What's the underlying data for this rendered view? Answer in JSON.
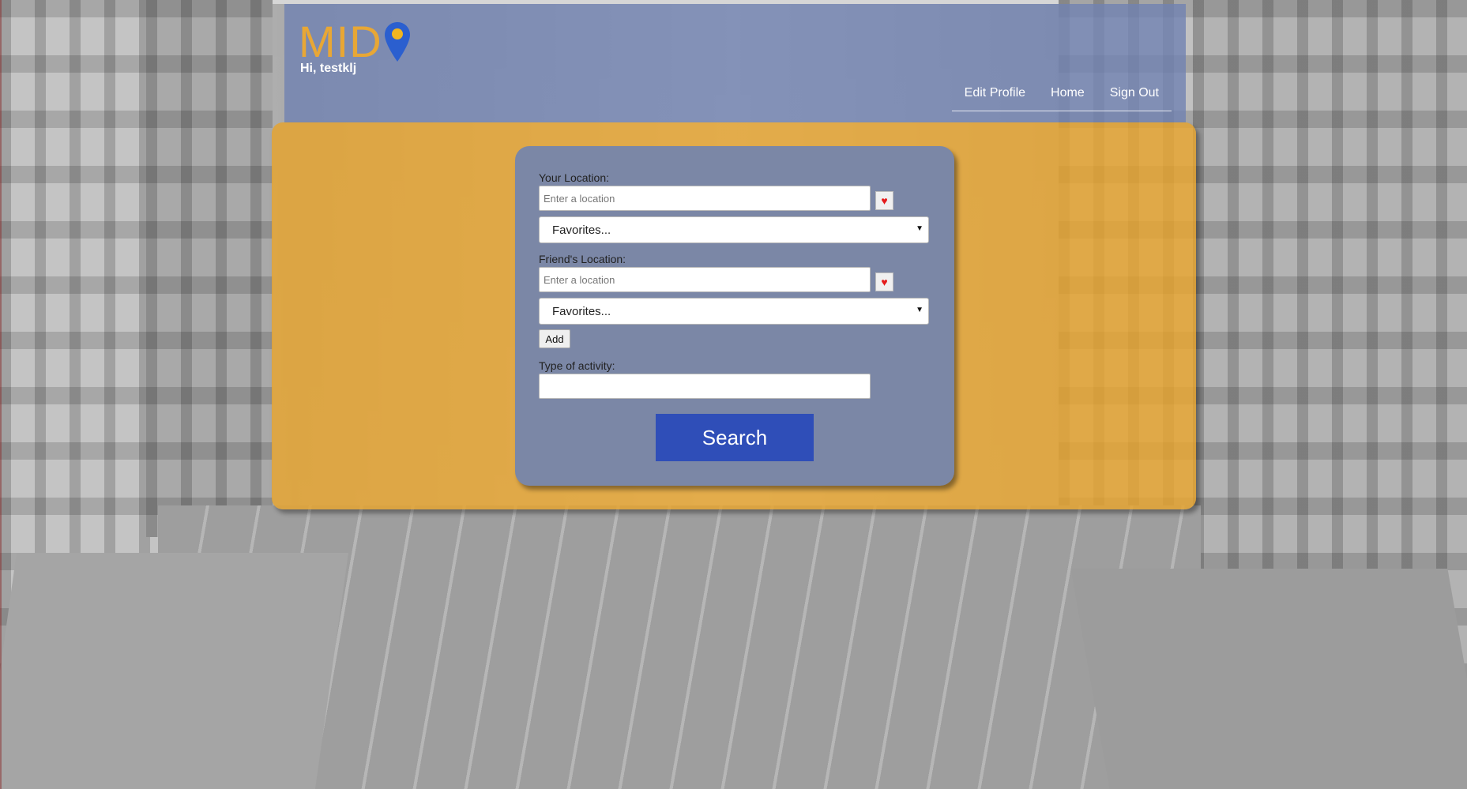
{
  "header": {
    "logo_text": "MID",
    "greeting": "Hi, testklj",
    "nav": {
      "edit_profile": "Edit Profile",
      "home": "Home",
      "sign_out": "Sign Out"
    }
  },
  "form": {
    "your_location": {
      "label": "Your Location:",
      "placeholder": "Enter a location",
      "value": "",
      "favorite_icon": "♥",
      "favorites_selected": "Favorites..."
    },
    "friend_location": {
      "label": "Friend's Location:",
      "placeholder": "Enter a location",
      "value": "",
      "favorite_icon": "♥",
      "favorites_selected": "Favorites..."
    },
    "add_label": "Add",
    "activity": {
      "label": "Type of activity:",
      "value": ""
    },
    "search_label": "Search"
  },
  "colors": {
    "header_bg": "#7182b2",
    "panel_bg": "#e6a32d",
    "card_bg": "#7b87a6",
    "search_button": "#2f4eb8",
    "logo": "#e8a735",
    "pin": "#2b5fcf",
    "heart": "#e41b1b"
  }
}
